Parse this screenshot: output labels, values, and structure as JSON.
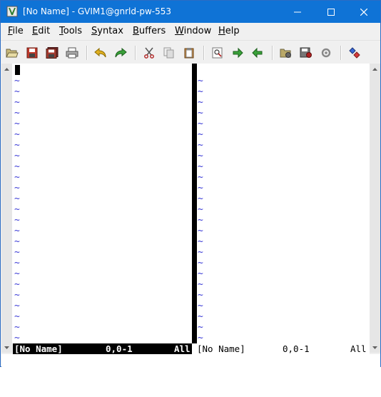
{
  "window": {
    "title": "[No Name] - GVIM1@gnrld-pw-553",
    "app_icon": "gvim-icon",
    "controls": [
      "minimize-icon",
      "maximize-icon",
      "close-icon"
    ]
  },
  "menubar": {
    "items": [
      {
        "key": "F",
        "rest": "ile"
      },
      {
        "key": "E",
        "rest": "dit"
      },
      {
        "key": "T",
        "rest": "ools"
      },
      {
        "key": "S",
        "rest": "yntax"
      },
      {
        "key": "B",
        "rest": "uffers"
      },
      {
        "key": "W",
        "rest": "indow"
      },
      {
        "key": "H",
        "rest": "elp"
      }
    ]
  },
  "toolbar": {
    "buttons": [
      "open-icon",
      "save-icon",
      "save-all-icon",
      "print-icon",
      "undo-icon",
      "redo-icon",
      "cut-icon",
      "copy-icon",
      "paste-icon",
      "find-replace-icon",
      "find-next-icon",
      "find-previous-icon",
      "load-session-icon",
      "save-session-icon",
      "run-script-icon",
      "make-icon"
    ]
  },
  "editor": {
    "tilde": "~",
    "left_status": {
      "name": "[No Name]",
      "position": "0,0-1",
      "scroll": "All"
    },
    "right_status": {
      "name": "[No Name]",
      "position": "0,0-1",
      "scroll": "All"
    }
  },
  "colors": {
    "titlebar": "#0f73d6",
    "tilde": "#3b3bd6",
    "status_active_bg": "#000000"
  }
}
